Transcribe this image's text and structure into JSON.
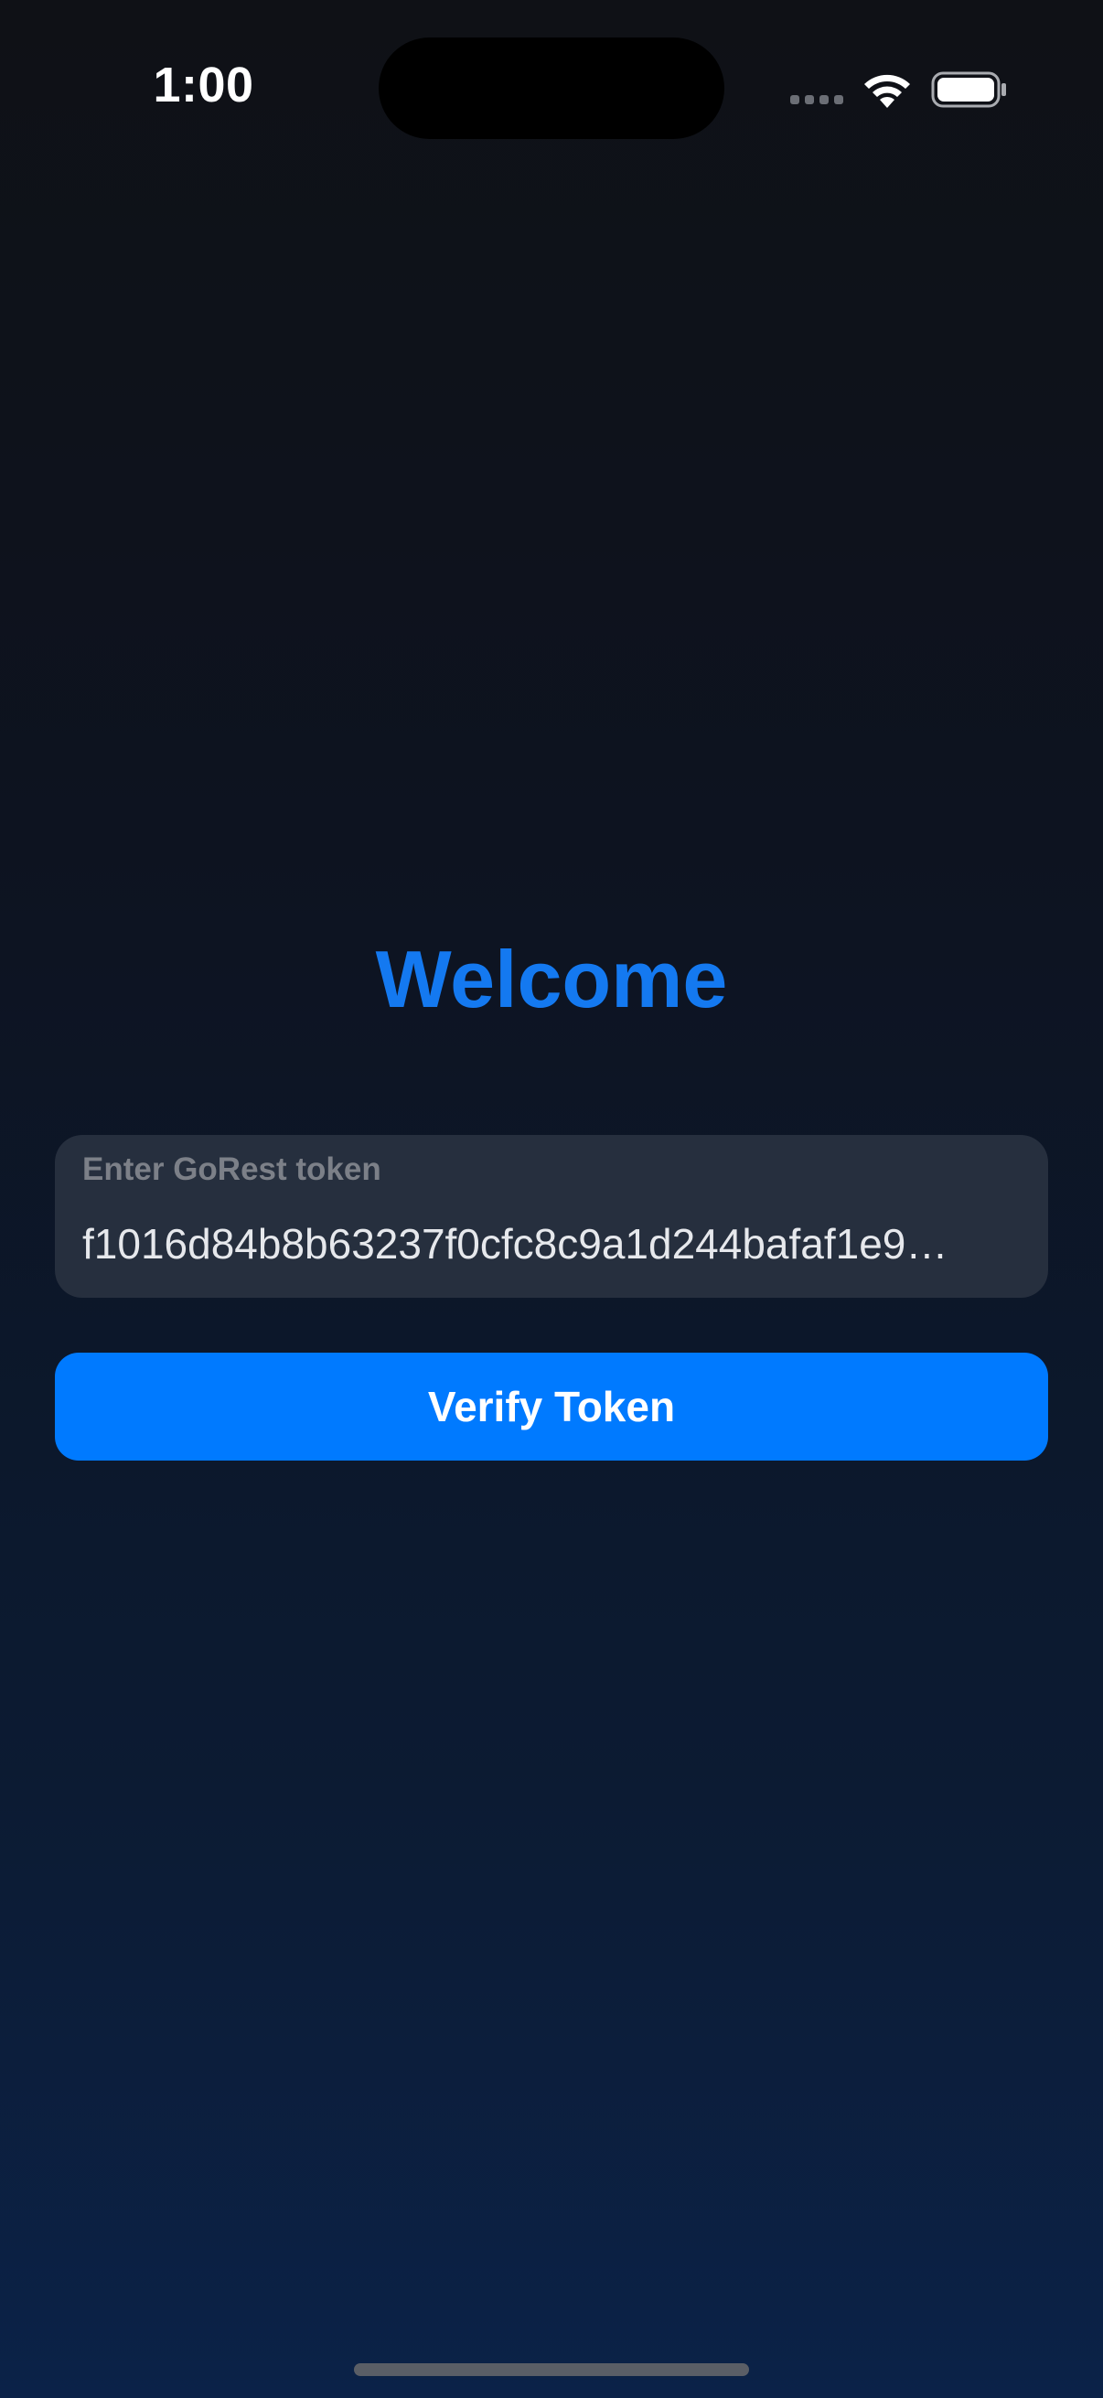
{
  "status_bar": {
    "time": "1:00",
    "icons": [
      "cellular-signal-icon",
      "wifi-icon",
      "battery-icon"
    ]
  },
  "main": {
    "title": "Welcome",
    "token_field": {
      "label": "Enter GoRest token",
      "value": "f1016d84b8b63237f0cfc8c9a1d244bafaf1e9…"
    },
    "verify_button_label": "Verify Token"
  },
  "colors": {
    "accent": "#007aff",
    "title": "#1479f0",
    "field_background": "#262f3e",
    "background_top": "#0f1116",
    "background_bottom": "#0b2248"
  }
}
